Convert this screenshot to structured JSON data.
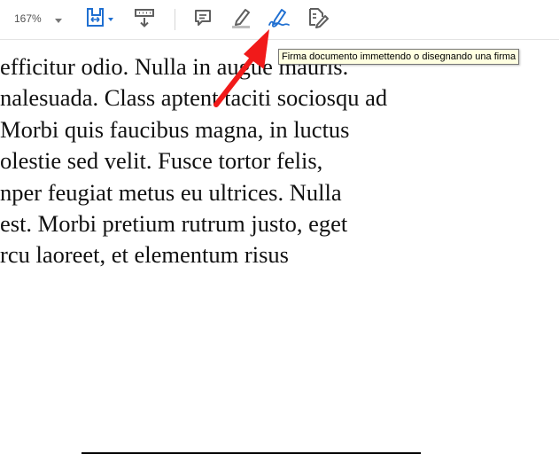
{
  "toolbar": {
    "zoom": {
      "value": "167%"
    },
    "tools": [
      {
        "name": "fit-page-icon"
      },
      {
        "name": "scroll-mode-icon"
      },
      {
        "name": "comment-icon"
      },
      {
        "name": "highlight-icon"
      },
      {
        "name": "sign-icon"
      },
      {
        "name": "edit-document-icon"
      }
    ]
  },
  "tooltip": {
    "text": "Firma documento immettendo o disegnando una firma"
  },
  "document": {
    "lines": [
      "efficitur odio. Nulla in augue mauris.",
      "nalesuada. Class aptent taciti sociosqu ad",
      " Morbi quis faucibus magna, in luctus",
      "olestie sed velit. Fusce tortor felis,",
      "nper feugiat metus eu ultrices. Nulla",
      " est. Morbi pretium rutrum justo, eget",
      "rcu laoreet, et elementum risus"
    ]
  },
  "colors": {
    "accent": "#1f6fd1",
    "icon_gray": "#5f5f5f",
    "annotation_arrow": "#f11a1a",
    "tooltip_bg": "#ffffe1"
  }
}
